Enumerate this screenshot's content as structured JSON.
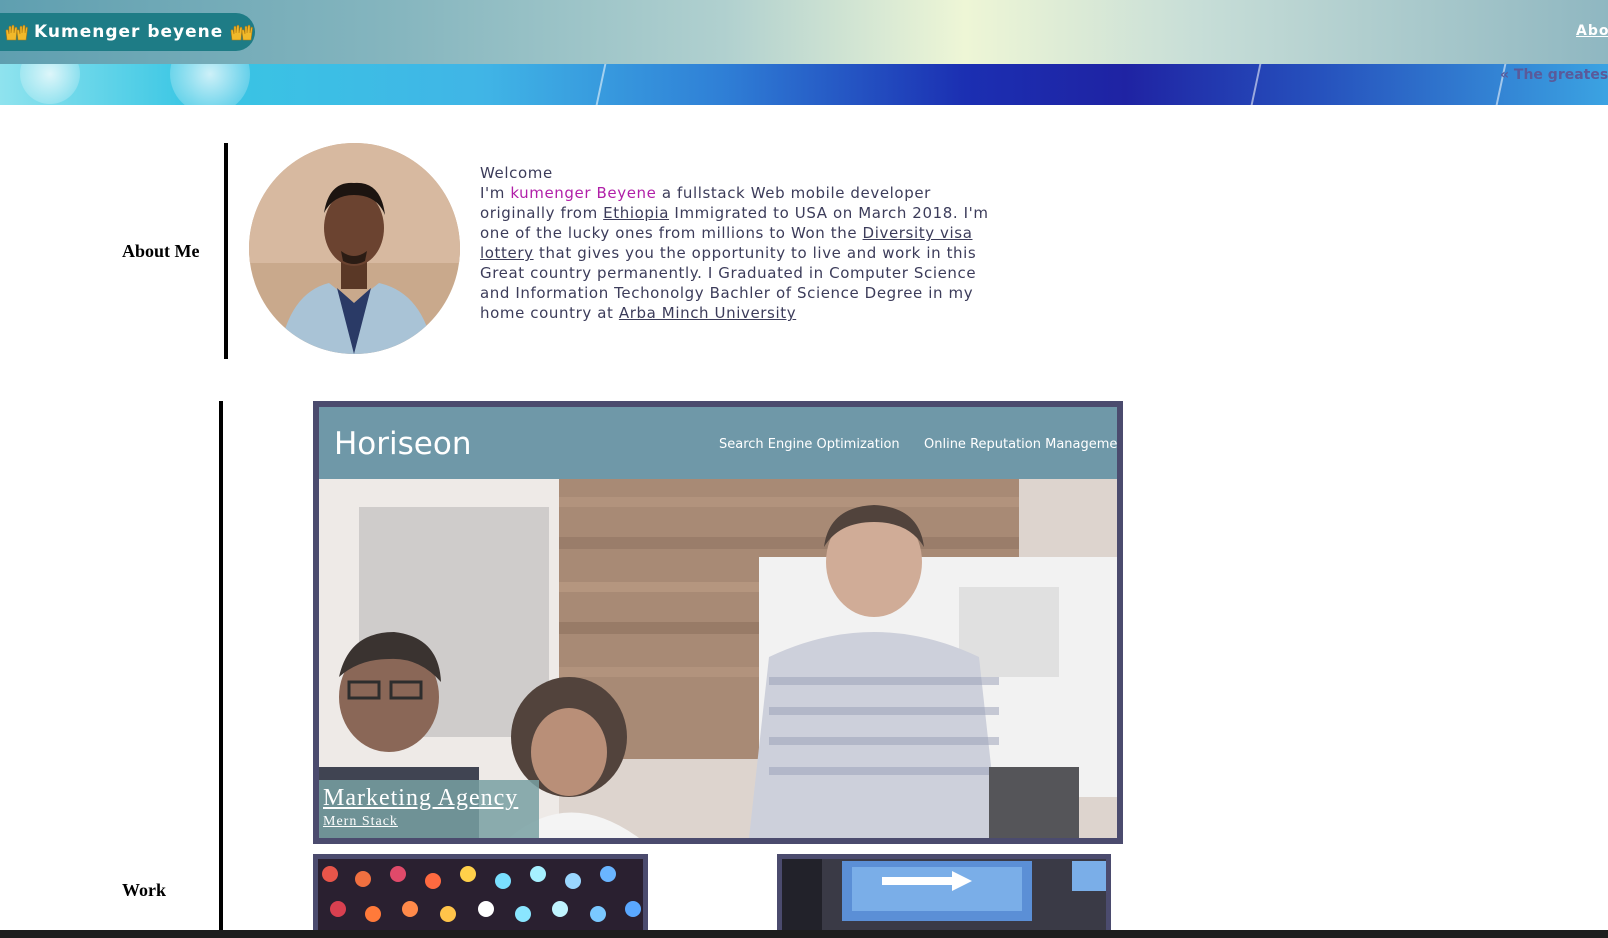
{
  "header": {
    "brand_name": "Kumenger beyene",
    "brand_icon": "raising-hands-icon",
    "nav_about": "About",
    "marquee_text": "« The greatest"
  },
  "about": {
    "section_label": "About Me",
    "welcome": "Welcome",
    "intro_prefix": "I'm ",
    "name": "kumenger Beyene",
    "text_1": " a fullstack Web mobile developer originally from ",
    "link_country": "Ethiopia",
    "text_2": "  Immigrated to USA on March 2018. I'm one of the lucky ones from millions to Won the ",
    "link_lottery": "Diversity visa lottery",
    "text_3": "   that gives you the opportunity to live and work in this Great country permanently. I Graduated in Computer Science and Information Techonolgy Bachler of Science Degree in my home country at ",
    "link_university": "Arba Minch University",
    "name_color": "#b01fa8"
  },
  "work": {
    "section_label": "Work",
    "featured": {
      "title": "Marketing Agency",
      "subtitle": "Mern Stack",
      "screenshot": {
        "site_logo": "Horiseon",
        "nav_items": [
          "Search Engine Optimization",
          "Online Reputation Manageme"
        ]
      }
    }
  },
  "colors": {
    "brand_bg": "#1e7c86",
    "card_border": "#4b4b6e",
    "caption_bg": "#78a0a2"
  }
}
